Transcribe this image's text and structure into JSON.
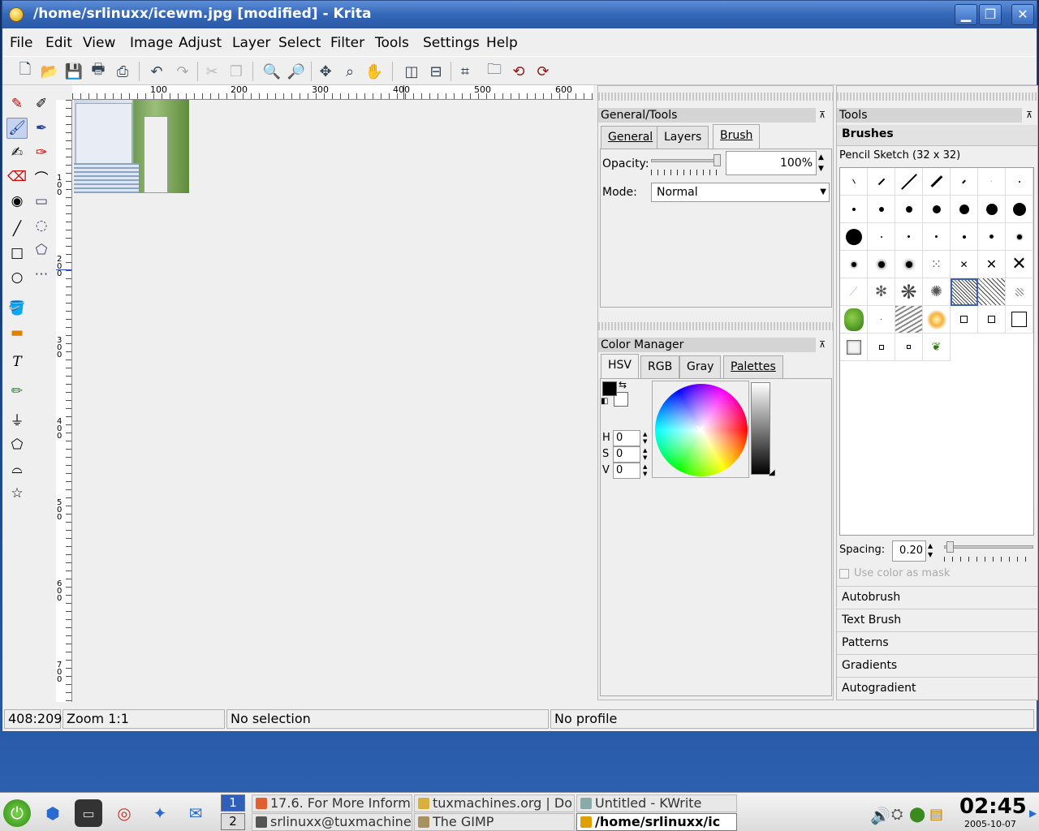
{
  "window": {
    "title": "/home/srlinuxx/icewm.jpg [modified] - Krita",
    "minimize_glyph": "▁",
    "maximize_glyph": "❐",
    "close_glyph": "✕"
  },
  "menubar": [
    "File",
    "Edit",
    "View",
    "Image",
    "Adjust",
    "Layer",
    "Select",
    "Filter",
    "Tools",
    "Settings",
    "Help"
  ],
  "toolbar_icons": [
    "new-icon",
    "open-icon",
    "save-icon",
    "print-icon",
    "print-preview-icon",
    "undo-icon",
    "redo-icon",
    "cut-icon",
    "copy-icon",
    "zoom-in-icon",
    "zoom-out-icon",
    "move-icon",
    "zoom-icon",
    "pan-icon",
    "layout-a-icon",
    "layout-b-icon",
    "crop-icon",
    "folder-icon",
    "rotate-ccw-icon",
    "rotate-cw-icon"
  ],
  "rulers": {
    "h_labels": [
      "100",
      "200",
      "300",
      "400",
      "500",
      "600"
    ],
    "v_labels": [
      "100",
      "200",
      "300",
      "400",
      "500",
      "600",
      "700"
    ]
  },
  "general_tools": {
    "title": "General/Tools",
    "tabs": [
      "General",
      "Layers",
      "Brush"
    ],
    "active_tab": "Brush",
    "opacity_label": "Opacity:",
    "opacity_value": "100%",
    "mode_label": "Mode:",
    "mode_value": "Normal"
  },
  "color_manager": {
    "title": "Color Manager",
    "tabs": [
      "HSV",
      "RGB",
      "Gray",
      "Palettes"
    ],
    "active_tab": "HSV",
    "h_label": "H",
    "h_value": "0",
    "s_label": "S",
    "s_value": "0",
    "v_label": "V",
    "v_value": "0",
    "foreground": "#000000",
    "background": "#ffffff"
  },
  "tools_panel": {
    "title": "Tools",
    "section": "Brushes",
    "current_brush": "Pencil Sketch (32 x 32)",
    "spacing_label": "Spacing:",
    "spacing_value": "0.20",
    "mask_label": "Use color as mask",
    "drawers": [
      "Autobrush",
      "Text Brush",
      "Patterns",
      "Gradients",
      "Autogradient"
    ]
  },
  "statusbar": {
    "coords": "408:209",
    "zoom": "Zoom 1:1",
    "selection": "No selection",
    "profile": "No profile"
  },
  "taskbar": {
    "desktops": [
      "1",
      "2"
    ],
    "tasks": [
      {
        "label": "17.6. For More Inform"
      },
      {
        "label": "tuxmachines.org | Do"
      },
      {
        "label": "Untitled - KWrite"
      },
      {
        "label": "srlinuxx@tuxmachine"
      },
      {
        "label": "The GIMP"
      },
      {
        "label": "/home/srlinuxx/ic"
      }
    ],
    "clock_time": "02:45",
    "clock_date": "2005-10-07"
  }
}
